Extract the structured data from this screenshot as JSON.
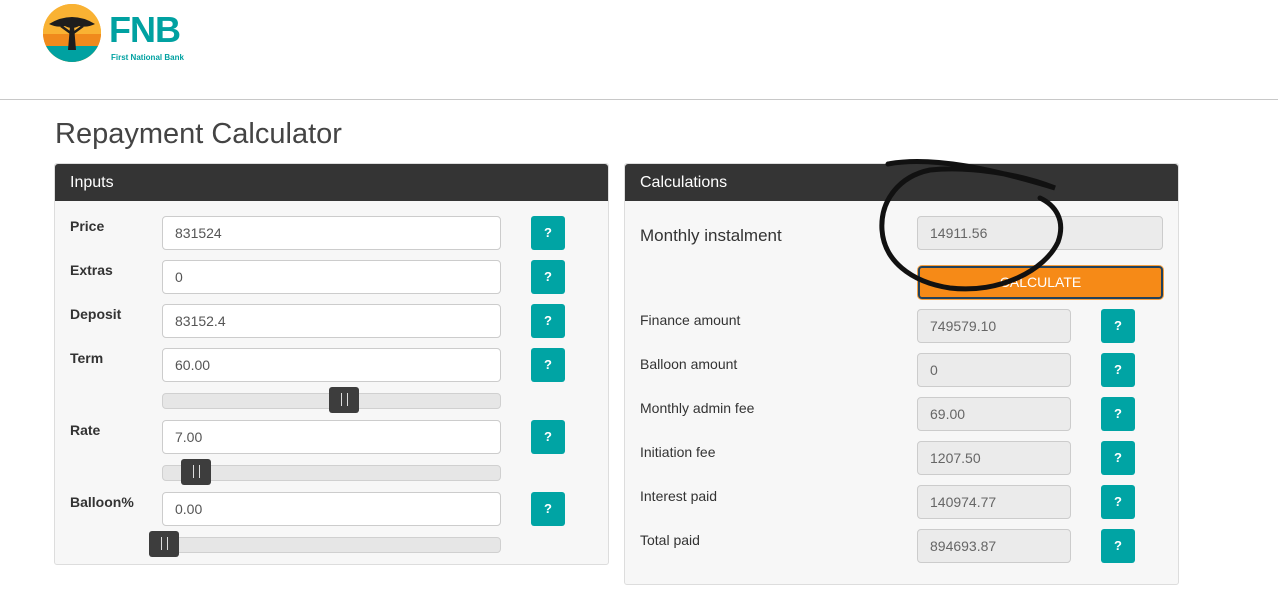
{
  "brand": {
    "name": "FNB",
    "tagline": "First National Bank",
    "accent": "#00a1a1",
    "orange": "#f7a11a"
  },
  "page": {
    "title": "Repayment Calculator"
  },
  "inputs": {
    "header": "Inputs",
    "help_label": "?",
    "price": {
      "label": "Price",
      "value": "831524"
    },
    "extras": {
      "label": "Extras",
      "value": "0"
    },
    "deposit": {
      "label": "Deposit",
      "value": "83152.4"
    },
    "term": {
      "label": "Term",
      "value": "60.00",
      "slider_fraction": 0.56
    },
    "rate": {
      "label": "Rate",
      "value": "7.00",
      "slider_fraction": 0.1
    },
    "balloon": {
      "label": "Balloon%",
      "value": "0.00",
      "slider_fraction": 0.0
    }
  },
  "calculations": {
    "header": "Calculations",
    "help_label": "?",
    "monthly_instalment": {
      "label": "Monthly instalment",
      "value": "14911.56"
    },
    "calculate_label": "CALCULATE",
    "finance_amount": {
      "label": "Finance amount",
      "value": "749579.10"
    },
    "balloon_amount": {
      "label": "Balloon amount",
      "value": "0"
    },
    "monthly_admin_fee": {
      "label": "Monthly admin fee",
      "value": "69.00"
    },
    "initiation_fee": {
      "label": "Initiation fee",
      "value": "1207.50"
    },
    "interest_paid": {
      "label": "Interest paid",
      "value": "140974.77"
    },
    "total_paid": {
      "label": "Total paid",
      "value": "894693.87"
    }
  }
}
